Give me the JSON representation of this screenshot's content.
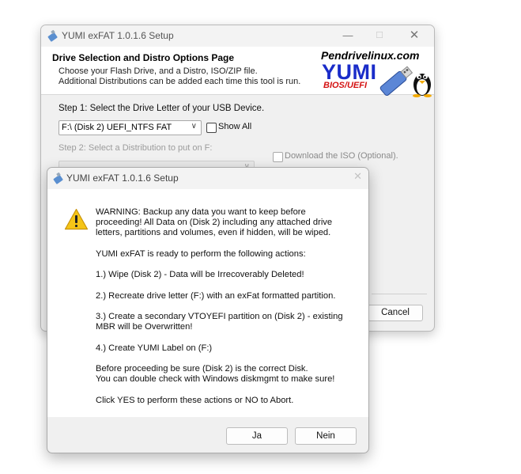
{
  "main_window": {
    "title": "YUMI exFAT 1.0.1.6 Setup",
    "controls": {
      "minimize": "—",
      "maximize": "☐",
      "close": "✕"
    },
    "header": {
      "title": "Drive Selection and Distro Options Page",
      "desc_line1": "Choose your Flash Drive, and a Distro, ISO/ZIP file.",
      "desc_line2": "Additional Distributions can be added each time this tool is run.",
      "logo_site": "Pendrivelinux.com",
      "logo_name": "YUMI",
      "logo_sub": "BIOS/UEFI"
    },
    "step1_label": "Step 1: Select the Drive Letter of your USB Device.",
    "drive_select_value": "F:\\ (Disk 2) UEFI_NTFS  FAT",
    "show_all_label": "Show All",
    "step2_label": "Step 2: Select a Distribution to put on F:",
    "download_iso_label": "Download the ISO (Optional).",
    "cancel_label": "Cancel"
  },
  "dialog": {
    "title": "YUMI exFAT 1.0.1.6 Setup",
    "close": "✕",
    "message": [
      "WARNING: Backup any data you want to keep before\nproceeding! All Data on (Disk 2) including any attached drive\nletters, partitions and volumes, even if hidden, will be wiped.",
      "YUMI exFAT is ready to perform the following actions:",
      "1.) Wipe (Disk 2) - Data will be Irrecoverably Deleted!",
      "2.) Recreate drive letter (F:) with an exFat formatted partition.",
      "3.) Create a secondary VTOYEFI partition on (Disk 2) - existing\nMBR will be Overwritten!",
      "4.) Create YUMI Label on (F:)",
      "Before proceeding be sure (Disk 2) is the correct Disk.\nYou can double check with Windows diskmgmt to make sure!",
      "Click YES to perform these actions or NO to Abort."
    ],
    "yes_label": "Ja",
    "no_label": "Nein"
  },
  "colors": {
    "logo_blue": "#1a2cc9",
    "logo_red": "#d41212",
    "warning_yellow": "#f5c518"
  }
}
